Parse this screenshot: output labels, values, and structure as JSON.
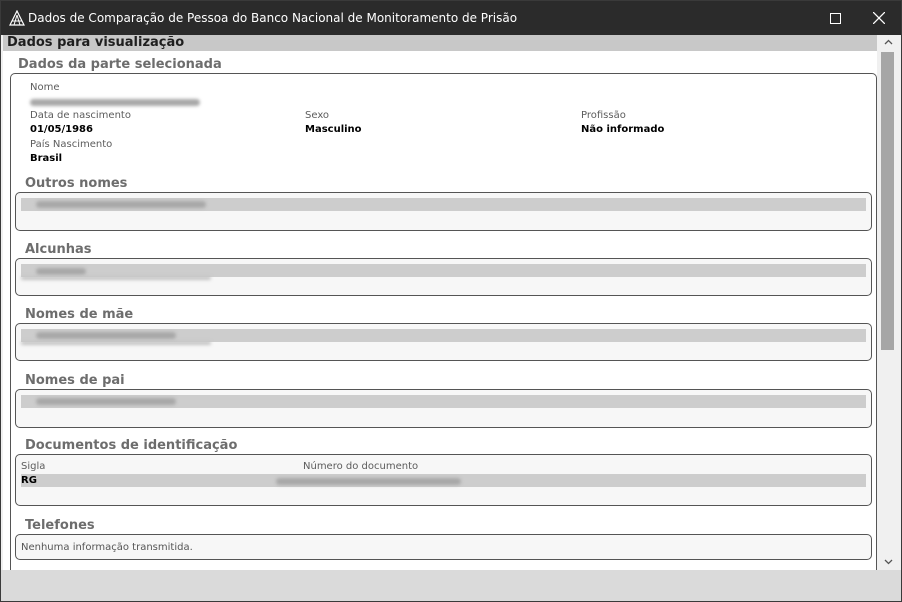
{
  "window": {
    "title": "Dados de Comparação de Pessoa do Banco Nacional de Monitoramento de Prisão"
  },
  "section_header": "Dados para visualização",
  "selected_party": {
    "title": "Dados da parte selecionada",
    "name_label": "Nome",
    "birth_label": "Data de nascimento",
    "birth_value": "01/05/1986",
    "sex_label": "Sexo",
    "sex_value": "Masculino",
    "profession_label": "Profissão",
    "profession_value": "Não informado",
    "country_label": "País Nascimento",
    "country_value": "Brasil"
  },
  "other_names": {
    "title": "Outros nomes"
  },
  "nicknames": {
    "title": "Alcunhas"
  },
  "mother_names": {
    "title": "Nomes de mãe"
  },
  "father_names": {
    "title": "Nomes de pai"
  },
  "documents": {
    "title": "Documentos de identificação",
    "col_sigla": "Sigla",
    "col_numero": "Número do documento",
    "rows": [
      {
        "sigla": "RG"
      }
    ]
  },
  "phones": {
    "title": "Telefones",
    "empty_message": "Nenhuma informação transmitida."
  },
  "colors": {
    "titlebar": "#2b2b2b",
    "header_band": "#c8c8c8",
    "section_title": "#6d6d6d"
  },
  "icons": [
    "app-logo-icon",
    "maximize-icon",
    "close-icon",
    "scroll-up-icon",
    "scroll-down-icon"
  ]
}
